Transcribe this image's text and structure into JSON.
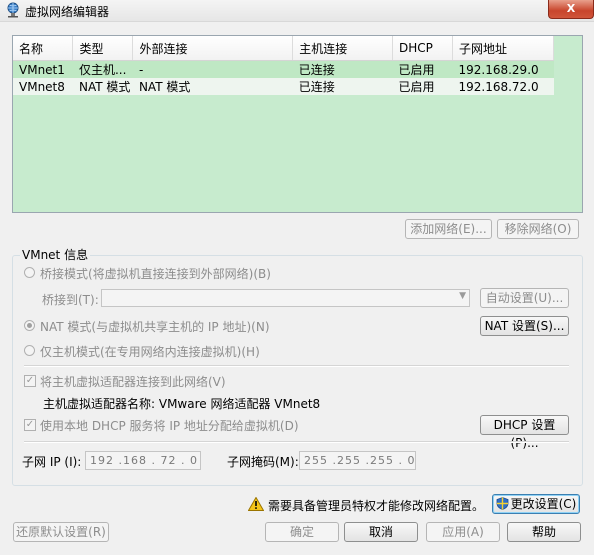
{
  "window": {
    "title": "虚拟网络编辑器",
    "close_label": "X"
  },
  "table": {
    "columns": [
      "名称",
      "类型",
      "外部连接",
      "主机连接",
      "DHCP",
      "子网地址"
    ],
    "rows": [
      [
        "VMnet1",
        "仅主机...",
        "-",
        "已连接",
        "已启用",
        "192.168.29.0"
      ],
      [
        "VMnet8",
        "NAT 模式",
        "NAT 模式",
        "已连接",
        "已启用",
        "192.168.72.0"
      ]
    ]
  },
  "buttons": {
    "add_network": "添加网络(E)...",
    "remove_network": "移除网络(O)",
    "auto_settings": "自动设置(U)...",
    "nat_settings": "NAT 设置(S)...",
    "dhcp_settings": "DHCP 设置(P)...",
    "change_settings": "更改设置(C)",
    "restore_defaults": "还原默认设置(R)",
    "ok": "确定",
    "cancel": "取消",
    "apply": "应用(A)",
    "help": "帮助"
  },
  "vmnet_info": {
    "group_title": "VMnet 信息",
    "bridged_mode": "桥接模式(将虚拟机直接连接到外部网络)(B)",
    "bridged_to_label": "桥接到(T):",
    "bridged_to_value": "",
    "nat_mode": "NAT 模式(与虚拟机共享主机的 IP 地址)(N)",
    "host_only_mode": "仅主机模式(在专用网络内连接虚拟机)(H)",
    "selected_mode": "nat",
    "connect_adapter": "将主机虚拟适配器连接到此网络(V)",
    "connect_adapter_checked": true,
    "adapter_name": "主机虚拟适配器名称: VMware 网络适配器 VMnet8",
    "use_dhcp": "使用本地 DHCP 服务将 IP 地址分配给虚拟机(D)",
    "use_dhcp_checked": true,
    "subnet_ip_label": "子网 IP (I):",
    "subnet_ip": "192 .168 . 72  . 0",
    "subnet_mask_label": "子网掩码(M):",
    "subnet_mask": "255 .255 .255 . 0"
  },
  "warning": {
    "text": "需要具备管理员特权才能修改网络配置。",
    "icon": "warning-icon"
  },
  "colors": {
    "table_bg": "#c7ebce",
    "selected_row": "#bfe8c4",
    "close_button": "#c8452c"
  }
}
